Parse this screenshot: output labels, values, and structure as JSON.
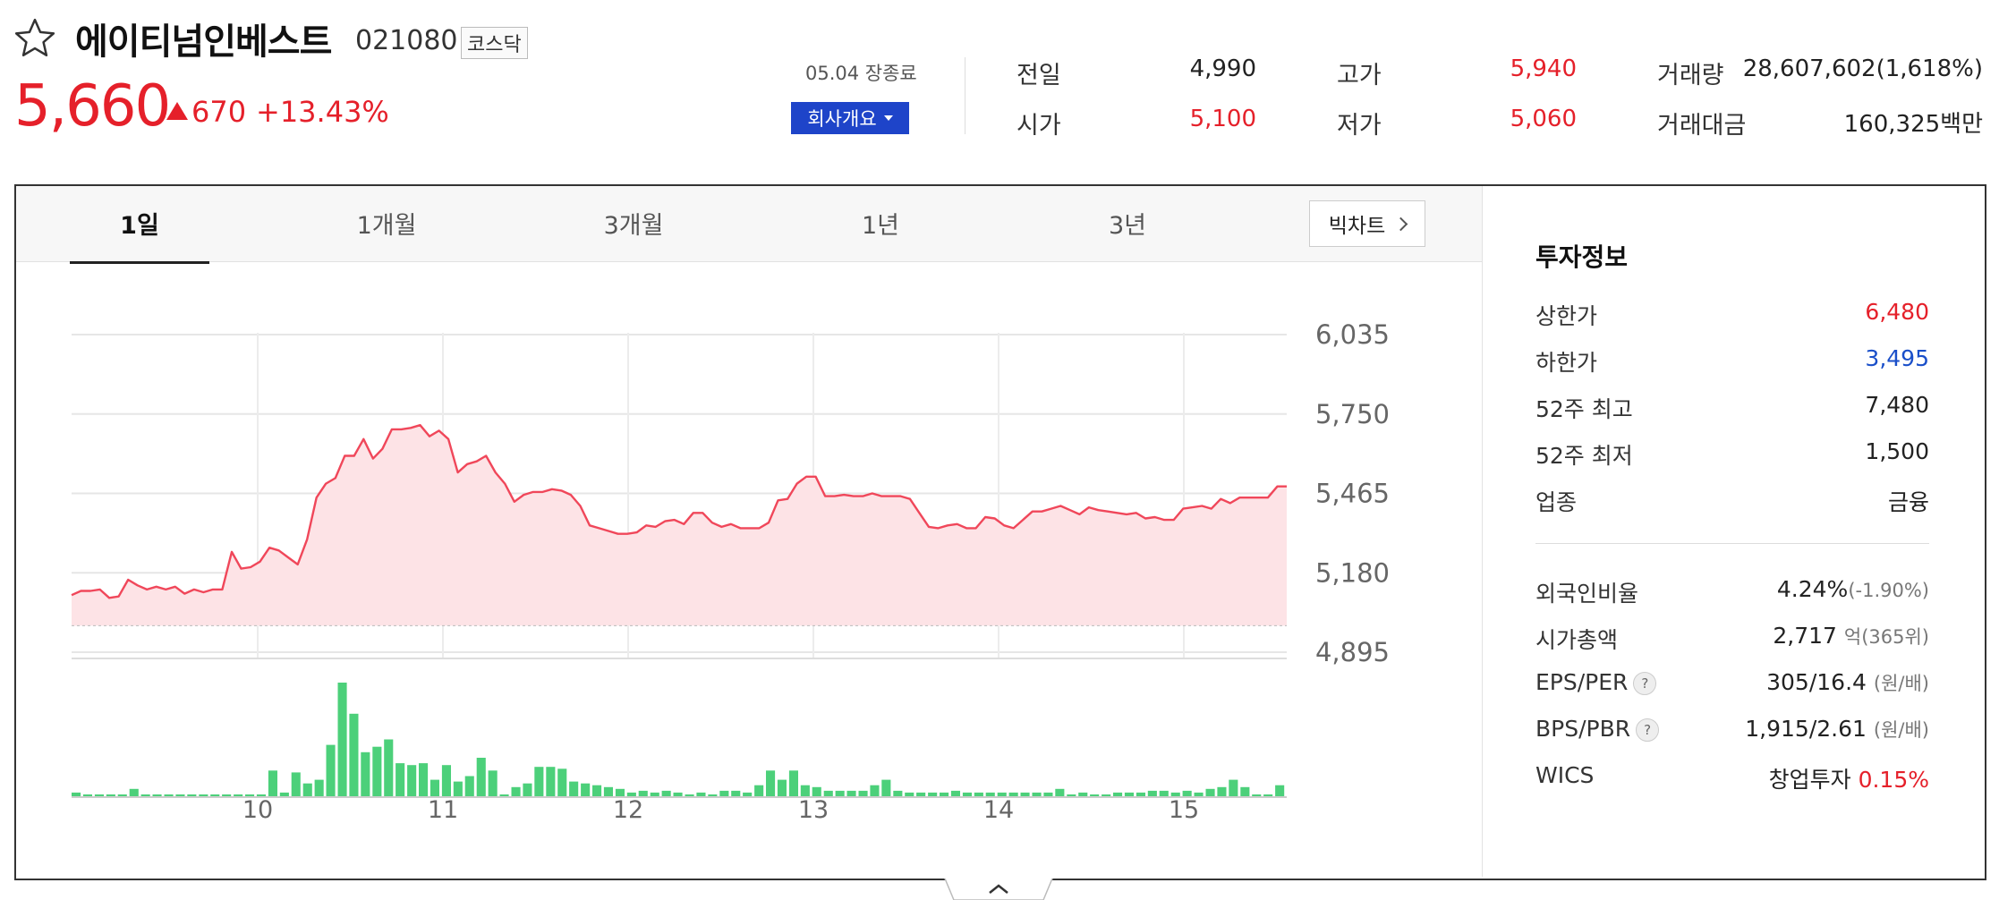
{
  "header": {
    "stock_name": "에이티넘인베스트",
    "stock_code": "021080",
    "market": "코스닥",
    "current_price": "5,660",
    "change_amount": "670",
    "change_percent": "+13.43%",
    "close_time": "05.04 장종료",
    "company_button": "회사개요"
  },
  "quote": {
    "prev_close_label": "전일",
    "prev_close": "4,990",
    "open_label": "시가",
    "open": "5,100",
    "high_label": "고가",
    "high": "5,940",
    "low_label": "저가",
    "low": "5,060",
    "volume_label": "거래량",
    "volume": "28,607,602(1,618%)",
    "amount_label": "거래대금",
    "amount": "160,325백만"
  },
  "tabs": [
    "1일",
    "1개월",
    "3개월",
    "1년",
    "3년"
  ],
  "active_tab": "1일",
  "big_chart_button": "빅차트",
  "invest_info": {
    "title": "투자정보",
    "upper_limit_label": "상한가",
    "upper_limit": "6,480",
    "lower_limit_label": "하한가",
    "lower_limit": "3,495",
    "high52_label": "52주 최고",
    "high52": "7,480",
    "low52_label": "52주 최저",
    "low52": "1,500",
    "industry_label": "업종",
    "industry": "금융",
    "foreign_label": "외국인비율",
    "foreign": "4.24%",
    "foreign_change": "(-1.90%)",
    "marketcap_label": "시가총액",
    "marketcap": "2,717",
    "marketcap_unit": "억(365위)",
    "eps_per_label": "EPS/PER",
    "eps_per": "305/16.4",
    "eps_per_unit": "(원/배)",
    "bps_pbr_label": "BPS/PBR",
    "bps_pbr": "1,915/2.61",
    "bps_pbr_unit": "(원/배)",
    "wics_label": "WICS",
    "wics": "창업투자",
    "wics_change": "0.15%"
  },
  "colors": {
    "up": "#e5202a",
    "down": "#1a4fc9",
    "line": "#f0475a",
    "area": "#fde3e6",
    "volume": "#4cd07a",
    "button": "#1e44c9"
  },
  "chart_data": {
    "type": "line",
    "y_ticks": [
      "6,035",
      "5,750",
      "5,465",
      "5,180",
      "4,895"
    ],
    "ylim": [
      4895,
      6035
    ],
    "baseline": 4990,
    "x_ticks": [
      "10",
      "11",
      "12",
      "13",
      "14",
      "15"
    ],
    "grid": true,
    "series": [
      {
        "values": [
          5100,
          5115,
          5115,
          5120,
          5090,
          5095,
          5155,
          5135,
          5120,
          5130,
          5120,
          5130,
          5105,
          5120,
          5110,
          5120,
          5120,
          5255,
          5195,
          5200,
          5220,
          5270,
          5260,
          5235,
          5210,
          5300,
          5450,
          5500,
          5520,
          5600,
          5600,
          5660,
          5590,
          5625,
          5695,
          5695,
          5700,
          5710,
          5670,
          5690,
          5660,
          5540,
          5570,
          5580,
          5600,
          5540,
          5500,
          5435,
          5460,
          5470,
          5470,
          5480,
          5475,
          5460,
          5420,
          5350,
          5340,
          5330,
          5320,
          5320,
          5325,
          5350,
          5345,
          5365,
          5370,
          5355,
          5395,
          5395,
          5360,
          5345,
          5355,
          5340,
          5340,
          5340,
          5360,
          5440,
          5445,
          5500,
          5525,
          5525,
          5455,
          5455,
          5460,
          5455,
          5455,
          5465,
          5455,
          5455,
          5455,
          5445,
          5395,
          5345,
          5340,
          5350,
          5355,
          5340,
          5340,
          5380,
          5375,
          5350,
          5340,
          5370,
          5400,
          5400,
          5410,
          5420,
          5405,
          5390,
          5415,
          5405,
          5400,
          5395,
          5390,
          5395,
          5375,
          5380,
          5370,
          5370,
          5410,
          5415,
          5420,
          5410,
          5445,
          5430,
          5450,
          5450,
          5450,
          5450,
          5490,
          5490
        ]
      }
    ],
    "volume": [
      2,
      1,
      1,
      1,
      1,
      4,
      1,
      1,
      1,
      1,
      1,
      1,
      1,
      1,
      1,
      1,
      1,
      14,
      2,
      13,
      7,
      9,
      28,
      62,
      45,
      24,
      27,
      31,
      18,
      17,
      18,
      9,
      17,
      8,
      11,
      21,
      14,
      1,
      5,
      7,
      16,
      16,
      15,
      8,
      7,
      6,
      5,
      4,
      2,
      3,
      2,
      3,
      2,
      1,
      2,
      1,
      3,
      3,
      2,
      6,
      14,
      9,
      14,
      6,
      5,
      3,
      3,
      3,
      3,
      6,
      9,
      3,
      2,
      2,
      2,
      2,
      3,
      2,
      2,
      2,
      2,
      2,
      2,
      2,
      2,
      4,
      1,
      2,
      1,
      1,
      2,
      2,
      2,
      3,
      3,
      2,
      3,
      2,
      4,
      5,
      9,
      5,
      1,
      1,
      6
    ]
  }
}
